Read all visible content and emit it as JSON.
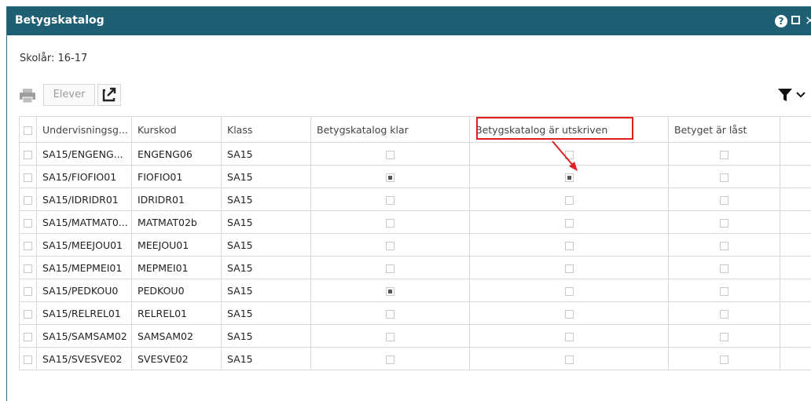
{
  "window": {
    "title": "Betygskatalog"
  },
  "schoolyear": {
    "text": "Skolår: 16-17"
  },
  "toolbar": {
    "elever_label": "Elever"
  },
  "table": {
    "headers": [
      "Undervisningsg...",
      "Kurskod",
      "Klass",
      "Betygskatalog klar",
      "Betygskatalog är utskriven",
      "Betyget är låst"
    ],
    "rows": [
      {
        "group": "SA15/ENGENG...",
        "course": "ENGENG06",
        "class": "SA15",
        "klar": false,
        "utskriven": false,
        "last": false
      },
      {
        "group": "SA15/FIOFIO01",
        "course": "FIOFIO01",
        "class": "SA15",
        "klar": true,
        "utskriven": true,
        "last": false
      },
      {
        "group": "SA15/IDRIDR01",
        "course": "IDRIDR01",
        "class": "SA15",
        "klar": false,
        "utskriven": false,
        "last": false
      },
      {
        "group": "SA15/MATMAT0...",
        "course": "MATMAT02b",
        "class": "SA15",
        "klar": false,
        "utskriven": false,
        "last": false
      },
      {
        "group": "SA15/MEEJOU01",
        "course": "MEEJOU01",
        "class": "SA15",
        "klar": false,
        "utskriven": false,
        "last": false
      },
      {
        "group": "SA15/MEPMEI01",
        "course": "MEPMEI01",
        "class": "SA15",
        "klar": false,
        "utskriven": false,
        "last": false
      },
      {
        "group": "SA15/PEDKOU0",
        "course": "PEDKOU0",
        "class": "SA15",
        "klar": true,
        "utskriven": false,
        "last": false
      },
      {
        "group": "SA15/RELREL01",
        "course": "RELREL01",
        "class": "SA15",
        "klar": false,
        "utskriven": false,
        "last": false
      },
      {
        "group": "SA15/SAMSAM02",
        "course": "SAMSAM02",
        "class": "SA15",
        "klar": false,
        "utskriven": false,
        "last": false
      },
      {
        "group": "SA15/SVESVE02",
        "course": "SVESVE02",
        "class": "SA15",
        "klar": false,
        "utskriven": false,
        "last": false
      }
    ]
  },
  "colors": {
    "titlebar": "#1f5f73",
    "highlight": "#e02020"
  },
  "icons": {
    "help": "question-circle-icon",
    "maximize": "maximize-icon",
    "close": "close-icon",
    "print": "printer-icon",
    "export": "export-icon",
    "filter": "filter-icon"
  }
}
